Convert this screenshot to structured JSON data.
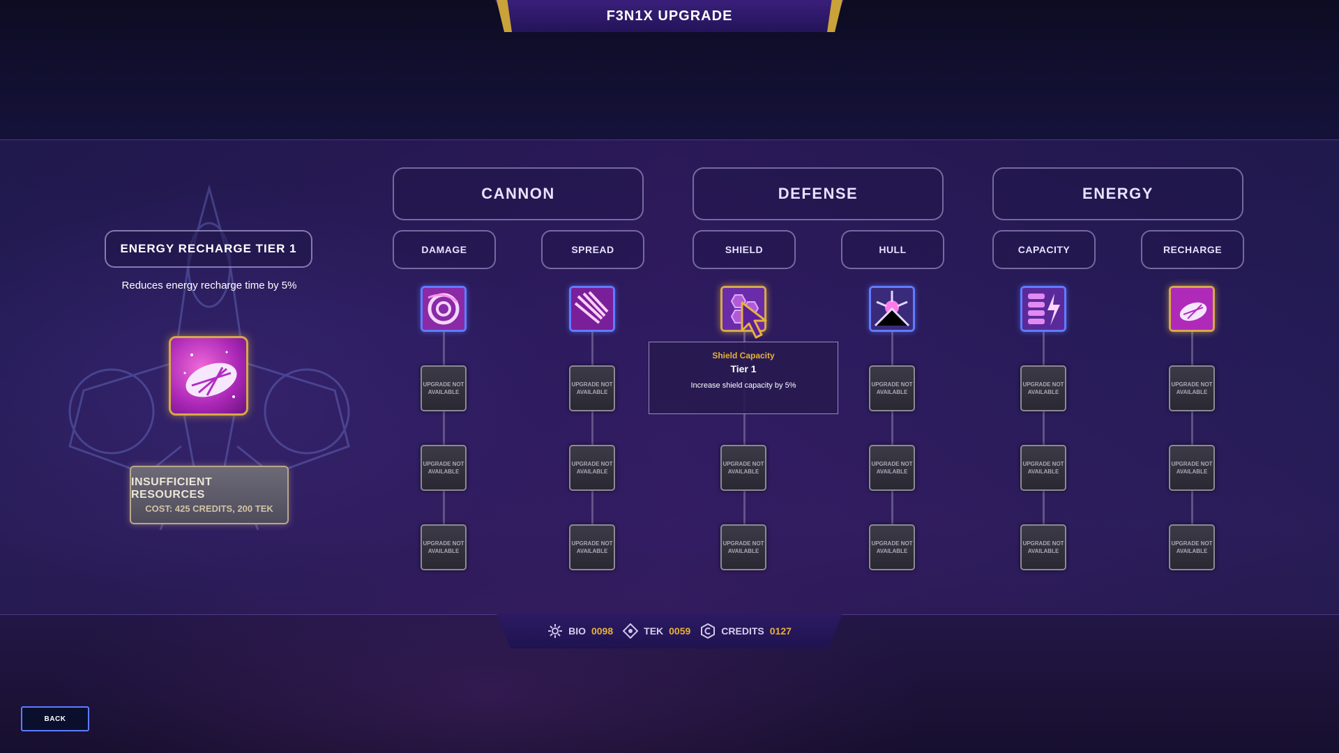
{
  "header": {
    "title": "F3N1X UPGRADE"
  },
  "detail": {
    "title": "ENERGY RECHARGE TIER 1",
    "description": "Reduces energy recharge time by 5%",
    "icon": "energy-recharge-icon",
    "status": "INSUFFICIENT RESOURCES",
    "cost": "COST: 425 CREDITS, 200 TEK"
  },
  "categories": [
    {
      "label": "CANNON",
      "subs": [
        "DAMAGE",
        "SPREAD"
      ]
    },
    {
      "label": "DEFENSE",
      "subs": [
        "SHIELD",
        "HULL"
      ]
    },
    {
      "label": "ENERGY",
      "subs": [
        "CAPACITY",
        "RECHARGE"
      ]
    }
  ],
  "locked_label": "UPGRADE NOT AVAILABLE",
  "tooltip": {
    "name": "Shield Capacity",
    "tier": "Tier 1",
    "description": "Increase shield capacity by 5%"
  },
  "resources": [
    {
      "name": "BIO",
      "value": "0098",
      "icon": "bio-icon"
    },
    {
      "name": "TEK",
      "value": "0059",
      "icon": "tek-icon"
    },
    {
      "name": "CREDITS",
      "value": "0127",
      "icon": "credits-icon"
    }
  ],
  "back_label": "BACK",
  "colors": {
    "accent_gold": "#d6a94a",
    "accent_blue": "#5f7cff",
    "resource_value": "#e6b23a"
  }
}
